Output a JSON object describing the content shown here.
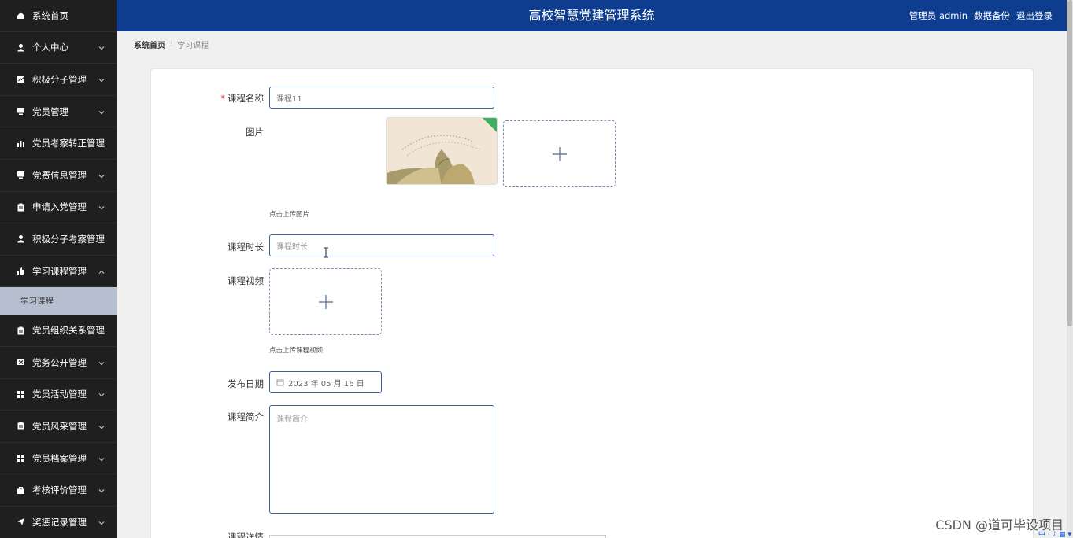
{
  "header": {
    "title": "高校智慧党建管理系统",
    "admin_label": "管理员 admin",
    "backup_label": "数据备份",
    "logout_label": "退出登录"
  },
  "sidebar": {
    "items": [
      {
        "label": "系统首页",
        "icon": "home-icon"
      },
      {
        "label": "个人中心",
        "icon": "user-icon"
      },
      {
        "label": "积极分子管理",
        "icon": "chart-icon"
      },
      {
        "label": "党员管理",
        "icon": "monitor-icon"
      },
      {
        "label": "党员考察转正管理",
        "icon": "bar-chart-icon"
      },
      {
        "label": "党费信息管理",
        "icon": "monitor-icon"
      },
      {
        "label": "申请入党管理",
        "icon": "clipboard-icon"
      },
      {
        "label": "积极分子考察管理",
        "icon": "user-icon"
      },
      {
        "label": "学习课程管理",
        "icon": "thumbs-up-icon"
      },
      {
        "label": "党员组织关系管理",
        "icon": "clipboard-icon"
      },
      {
        "label": "党务公开管理",
        "icon": "cross-icon"
      },
      {
        "label": "党员活动管理",
        "icon": "grid-icon"
      },
      {
        "label": "党员风采管理",
        "icon": "clipboard-icon"
      },
      {
        "label": "党员档案管理",
        "icon": "grid-icon"
      },
      {
        "label": "考核评价管理",
        "icon": "briefcase-icon"
      },
      {
        "label": "奖惩记录管理",
        "icon": "send-icon"
      }
    ],
    "active_sub": "学习课程"
  },
  "breadcrumb": {
    "home": "系统首页",
    "current": "学习课程"
  },
  "form": {
    "course_name_label": "课程名称",
    "course_name_value": "课程11",
    "image_label": "图片",
    "image_hint": "点击上传图片",
    "duration_label": "课程时长",
    "duration_placeholder": "课程时长",
    "video_label": "课程视频",
    "video_hint": "点击上传课程视频",
    "date_label": "发布日期",
    "date_value": "2023 年 05 月 16 日",
    "intro_label": "课程简介",
    "intro_placeholder": "课程简介",
    "detail_label": "课程详情"
  },
  "watermark": "CSDN @道可毕设项目",
  "tray": "中 · ♪ ▦ ▾"
}
